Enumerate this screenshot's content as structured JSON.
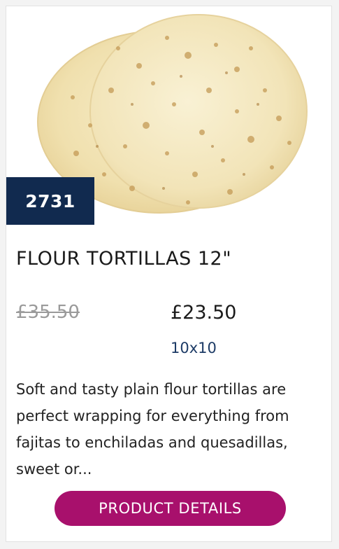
{
  "product": {
    "code": "2731",
    "title": "FLOUR TORTILLAS 12\"",
    "old_price": "£35.50",
    "price": "£23.50",
    "pack_size": "10x10",
    "description": "Soft and tasty plain flour tortillas are perfect wrapping for everything from fajitas to enchiladas and quesadillas, sweet or...",
    "button_label": "PRODUCT DETAILS",
    "image_icon": "tortillas-image"
  },
  "colors": {
    "badge_bg": "#112a4f",
    "button_bg": "#a8106c",
    "pack_text": "#1d3b66",
    "old_price_text": "#9a9a9a"
  }
}
